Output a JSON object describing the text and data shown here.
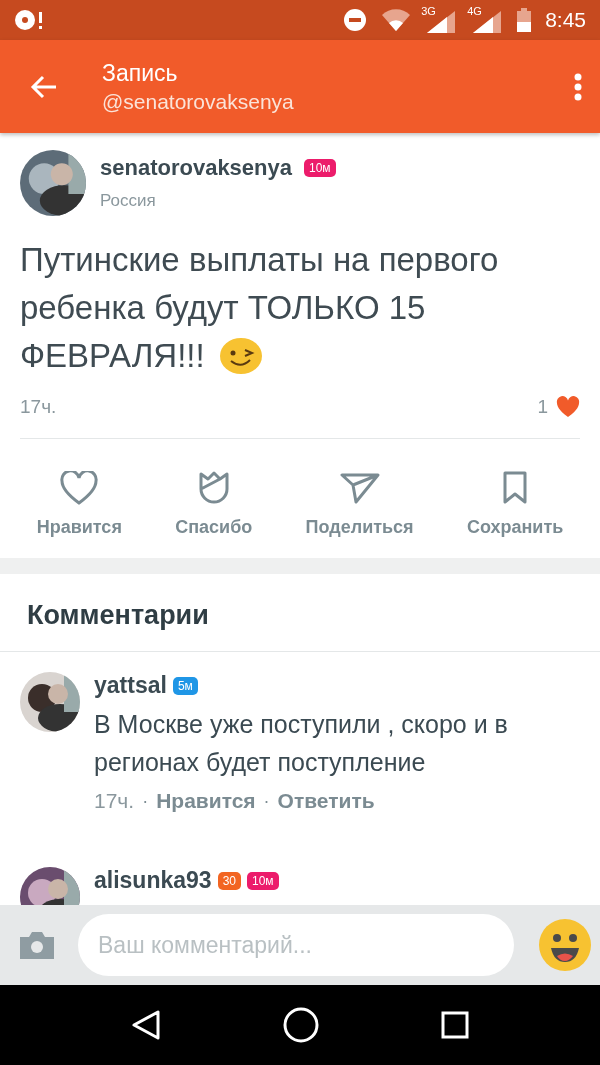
{
  "status_bar": {
    "time": "8:45",
    "network_1": "3G",
    "network_2": "4G"
  },
  "app_bar": {
    "title": "Запись",
    "subtitle": "@senatorovaksenya"
  },
  "post": {
    "author": "senatorovaksenya",
    "badges": [
      {
        "text": "10м",
        "color": "#ec1c6b"
      }
    ],
    "location": "Россия",
    "text_lines": [
      "Путинские выплаты на первого ребенка будут ТОЛЬКО 15",
      "ФЕВРАЛЯ!!!"
    ],
    "time": "17ч.",
    "likes": "1"
  },
  "actions": [
    {
      "kind": "like",
      "label": "Нравится"
    },
    {
      "kind": "thanks",
      "label": "Спасибо"
    },
    {
      "kind": "share",
      "label": "Поделиться"
    },
    {
      "kind": "save",
      "label": "Сохранить"
    }
  ],
  "comments_title": "Комментарии",
  "comments": [
    {
      "author": "yattsal",
      "badges": [
        {
          "text": "5м",
          "color": "#1f96e6"
        }
      ],
      "text": "В Москве уже поступили , скоро и в регионах будет поступление",
      "time": "17ч.",
      "separator": "·",
      "like": "Нравится",
      "reply": "Ответить"
    },
    {
      "author": "alisunka93",
      "badges": [
        {
          "text": "30",
          "color": "#f26522"
        },
        {
          "text": "10м",
          "color": "#ec1c6b"
        }
      ]
    }
  ],
  "comment_input": {
    "placeholder": "Ваш комментарий..."
  }
}
